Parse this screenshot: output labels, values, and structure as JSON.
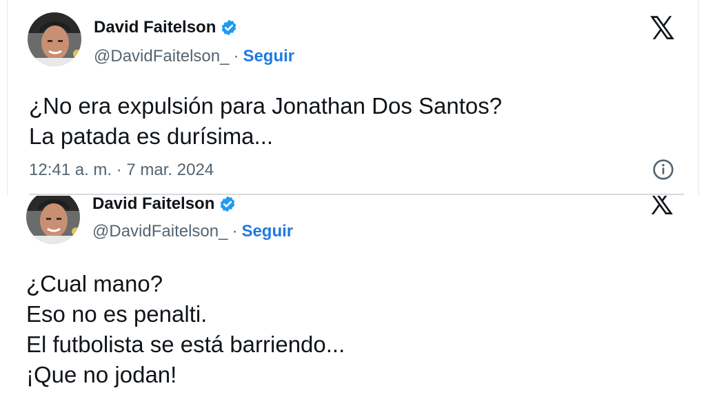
{
  "tweets": [
    {
      "author_name": "David Faitelson",
      "handle": "@DavidFaitelson_",
      "separator": "·",
      "follow_label": "Seguir",
      "text_lines": [
        "¿No era expulsión para Jonathan Dos Santos?",
        "La patada es durísima..."
      ],
      "timestamp": "12:41 a. m. · 7 mar. 2024"
    },
    {
      "author_name": "David Faitelson",
      "handle": "@DavidFaitelson_",
      "separator": "·",
      "follow_label": "Seguir",
      "text_lines": [
        "¿Cual mano?",
        "Eso no es penalti.",
        "El futbolista se está barriendo...",
        "¡Que no jodan!"
      ]
    }
  ],
  "icons": {
    "brand": "x-logo-icon",
    "verified": "verified-badge-icon",
    "info": "info-icon"
  },
  "colors": {
    "follow": "#1d7ae3",
    "verified": "#1d9bf0",
    "secondary_text": "#536471"
  }
}
